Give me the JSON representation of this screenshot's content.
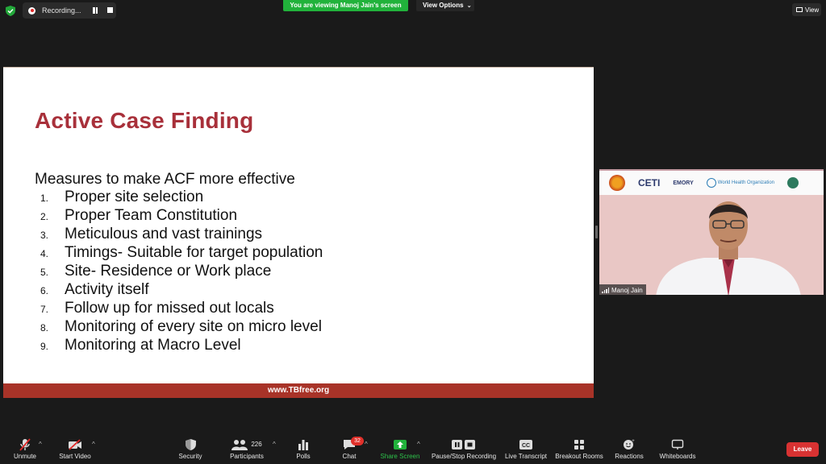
{
  "top_bar": {
    "recording_label": "Recording...",
    "viewing_banner": "You are viewing Manoj Jain's screen",
    "view_options_label": "View Options",
    "view_button_label": "View"
  },
  "slide": {
    "title": "Active Case Finding",
    "subtitle": "Measures to make ACF more effective",
    "items": [
      {
        "num": "1.",
        "text": "Proper site selection"
      },
      {
        "num": "2.",
        "text": "Proper Team Constitution"
      },
      {
        "num": "3.",
        "text": "Meticulous and vast trainings"
      },
      {
        "num": "4.",
        "text": "Timings- Suitable for target population"
      },
      {
        "num": "5.",
        "text": "Site- Residence or Work place"
      },
      {
        "num": "6.",
        "text": "Activity itself"
      },
      {
        "num": "7.",
        "text": "Follow up for missed out locals"
      },
      {
        "num": "8.",
        "text": "Monitoring of every site on micro level"
      },
      {
        "num": "9.",
        "text": "Monitoring at Macro Level"
      }
    ],
    "footer": "www.TBfree.org"
  },
  "video": {
    "participant_name": "Manoj Jain",
    "logos": {
      "ceti": "CETI",
      "emory": "EMORY",
      "who": "World Health Organization"
    }
  },
  "toolbar": {
    "unmute": "Unmute",
    "start_video": "Start Video",
    "security": "Security",
    "participants": "Participants",
    "participant_count": "226",
    "polls": "Polls",
    "chat": "Chat",
    "chat_badge": "32",
    "share_screen": "Share Screen",
    "pause_stop_recording": "Pause/Stop Recording",
    "live_transcript": "Live Transcript",
    "breakout_rooms": "Breakout Rooms",
    "reactions": "Reactions",
    "whiteboards": "Whiteboards",
    "leave": "Leave"
  },
  "colors": {
    "title_red": "#a8303a",
    "footer_red": "#a83328",
    "banner_green": "#21b23b",
    "leave_red": "#d83232"
  }
}
